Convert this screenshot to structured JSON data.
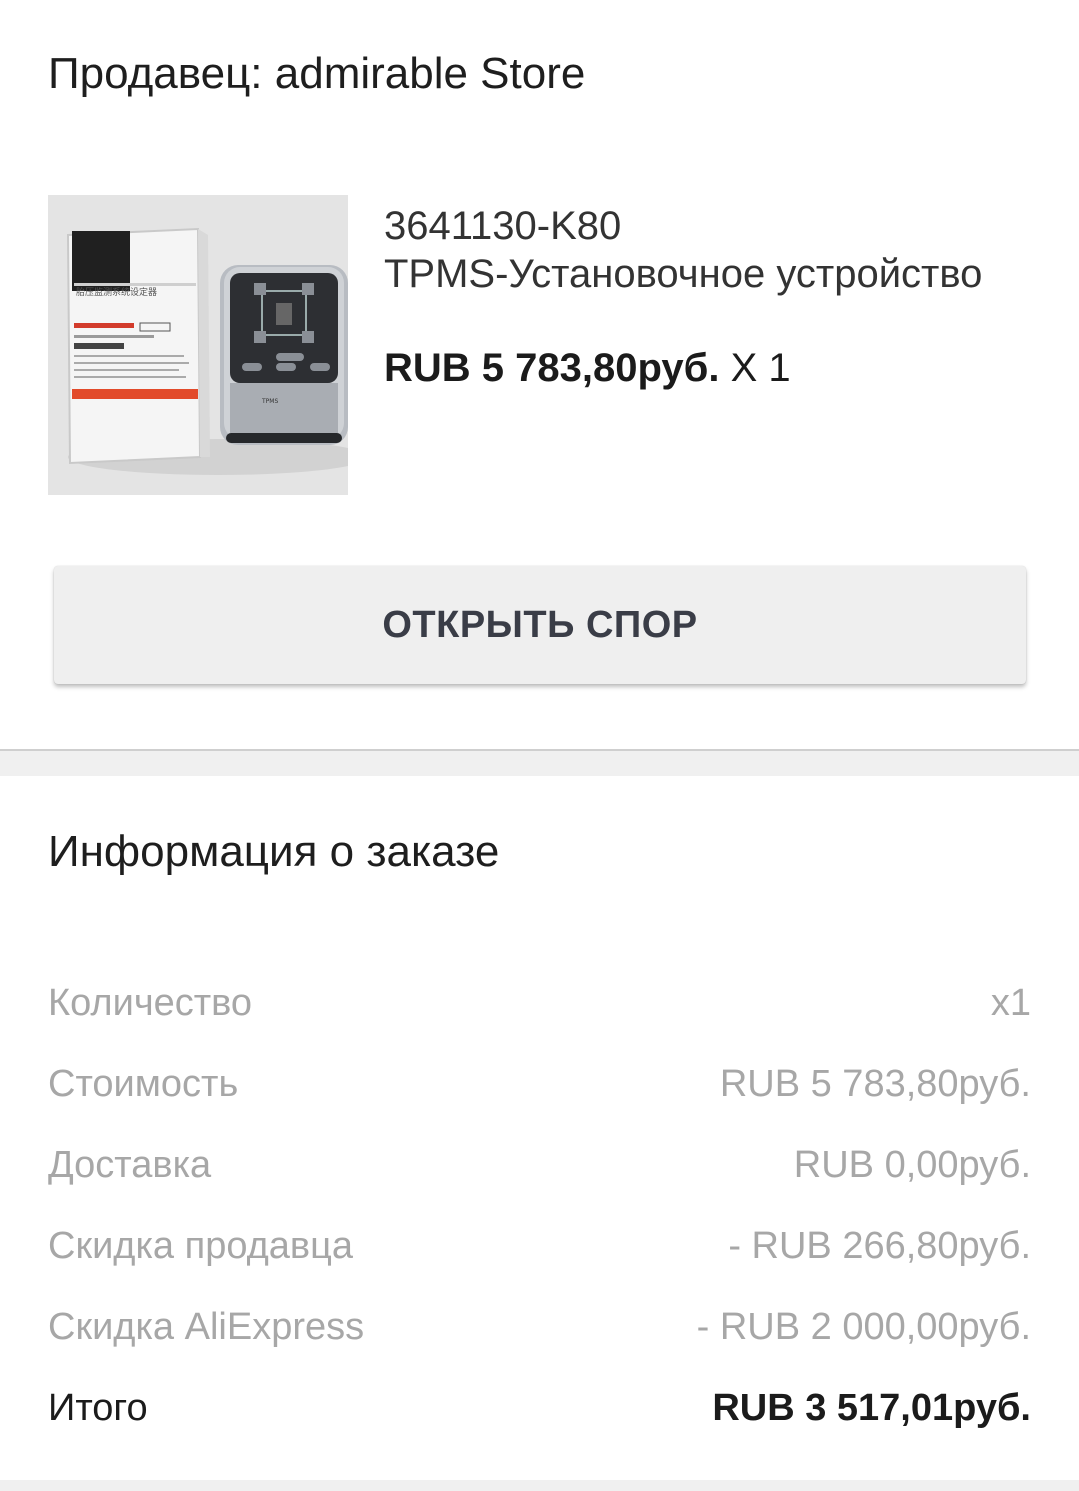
{
  "seller": {
    "label": "Продавец: admirable Store"
  },
  "product": {
    "title_line1": "3641130-K80",
    "title_line2": "TPMS-Установочное устройство",
    "price": "RUB 5 783,80руб.",
    "quantity": "X 1",
    "image_alt": "TPMS programming tool and box"
  },
  "actions": {
    "dispute_label": "ОТКРЫТЬ СПОР"
  },
  "order_info": {
    "title": "Информация о заказе",
    "rows": [
      {
        "label": "Количество",
        "value": "x1"
      },
      {
        "label": "Стоимость",
        "value": "RUB 5 783,80руб."
      },
      {
        "label": "Доставка",
        "value": "RUB 0,00руб."
      },
      {
        "label": "Скидка продавца",
        "value": "- RUB 266,80руб."
      },
      {
        "label": "Скидка AliExpress",
        "value": "- RUB 2 000,00руб."
      }
    ],
    "total": {
      "label": "Итого",
      "value": "RUB 3 517,01руб."
    }
  }
}
